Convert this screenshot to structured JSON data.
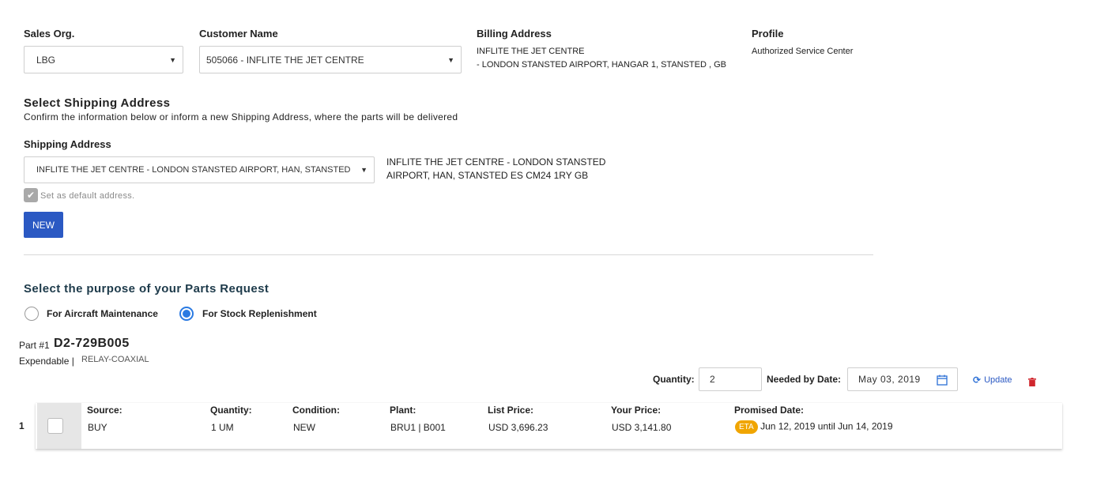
{
  "header": {
    "sales_org": {
      "label": "Sales Org.",
      "value": "LBG"
    },
    "customer": {
      "label": "Customer Name",
      "value": "505066 - INFLITE THE JET CENTRE"
    },
    "billing": {
      "label": "Billing Address",
      "line1": "INFLITE THE JET CENTRE",
      "line2": "- LONDON STANSTED AIRPORT, HANGAR 1, STANSTED , GB"
    },
    "profile": {
      "label": "Profile",
      "value": "Authorized Service Center"
    }
  },
  "shipping": {
    "title": "Select Shipping Address",
    "subtitle": "Confirm the information below or inform a new Shipping Address, where the parts will be delivered",
    "label": "Shipping Address",
    "selected": "INFLITE THE JET CENTRE - LONDON STANSTED AIRPORT, HAN, STANSTED",
    "address_line1": "INFLITE THE JET CENTRE - LONDON STANSTED",
    "address_line2": "AIRPORT, HAN, STANSTED ES CM24 1RY GB",
    "default_label": "Set as default address.",
    "new_button": "NEW"
  },
  "purpose": {
    "title": "Select the purpose of your Parts Request",
    "options": [
      {
        "label": "For Aircraft Maintenance",
        "selected": false
      },
      {
        "label": "For Stock Replenishment",
        "selected": true
      }
    ]
  },
  "part": {
    "prefix": "Part #1",
    "number": "D2-729B005",
    "type": "Expendable |",
    "description": "RELAY-COAXIAL",
    "quantity_label": "Quantity:",
    "quantity_value": "2",
    "needed_label": "Needed by Date:",
    "needed_value": "May 03, 2019",
    "update_label": "Update"
  },
  "row": {
    "index": "1",
    "source": {
      "label": "Source:",
      "value": "BUY"
    },
    "quantity": {
      "label": "Quantity:",
      "value": "1 UM"
    },
    "condition": {
      "label": "Condition:",
      "value": "NEW"
    },
    "plant": {
      "label": "Plant:",
      "value": "BRU1 | B001"
    },
    "list_price": {
      "label": "List Price:",
      "value": "USD 3,696.23"
    },
    "your_price": {
      "label": "Your Price:",
      "value": "USD 3,141.80"
    },
    "promised": {
      "label": "Promised Date:",
      "badge": "ETA",
      "value": "Jun 12, 2019 until Jun 14, 2019"
    }
  },
  "colors": {
    "primary": "#2b59c3",
    "radio": "#2a7ae2",
    "eta": "#f0a500",
    "delete": "#d0262d"
  }
}
